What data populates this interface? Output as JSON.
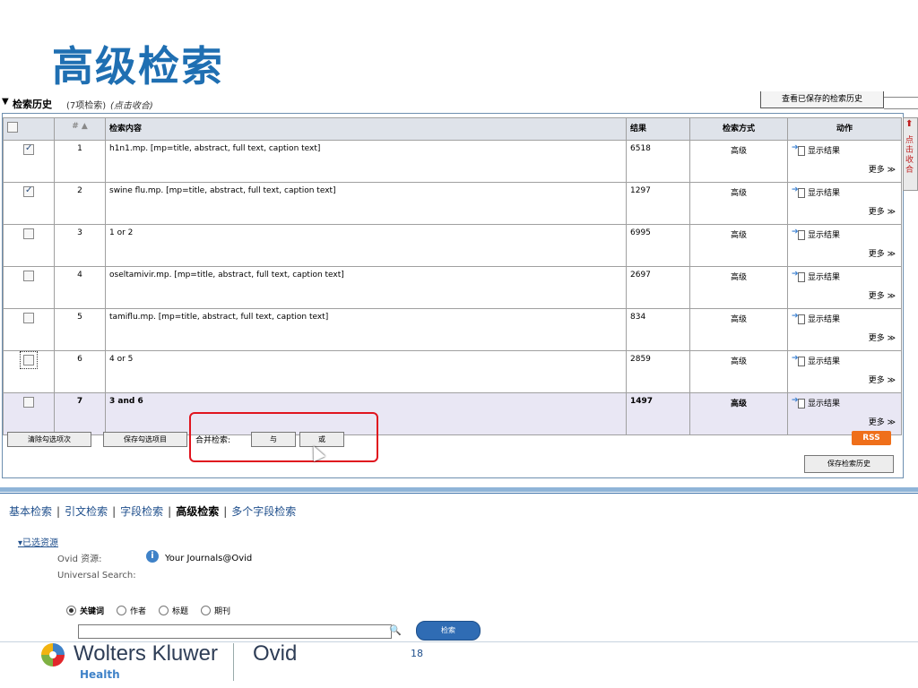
{
  "slide_title": "高级检索",
  "history": {
    "title": "检索历史",
    "count": "(7项检索)",
    "hint": "(点击收合)",
    "saved_button": "查看已保存的检索历史",
    "side_tab": "点击收合",
    "headers": {
      "num": "# ▲",
      "content": "检索内容",
      "results": "结果",
      "method": "检索方式",
      "action": "动作"
    },
    "show_label": "显示结果",
    "more_label": "更多 ≫",
    "rows": [
      {
        "checked": true,
        "num": "1",
        "content": "h1n1.mp. [mp=title, abstract, full text, caption text]",
        "results": "6518",
        "method": "高级"
      },
      {
        "checked": true,
        "num": "2",
        "content": "swine flu.mp. [mp=title, abstract, full text, caption text]",
        "results": "1297",
        "method": "高级"
      },
      {
        "checked": false,
        "num": "3",
        "content": "1 or 2",
        "results": "6995",
        "method": "高级"
      },
      {
        "checked": false,
        "num": "4",
        "content": "oseltamivir.mp. [mp=title, abstract, full text, caption text]",
        "results": "2697",
        "method": "高级"
      },
      {
        "checked": false,
        "num": "5",
        "content": "tamiflu.mp. [mp=title, abstract, full text, caption text]",
        "results": "834",
        "method": "高级"
      },
      {
        "checked": false,
        "num": "6",
        "content": "4 or 5",
        "results": "2859",
        "method": "高级"
      },
      {
        "checked": false,
        "num": "7",
        "content": "3 and 6",
        "results": "1497",
        "method": "高级"
      }
    ],
    "clear_button": "清除勾选项次",
    "save_selected_button": "保存勾选项目",
    "merge_label": "合并检索:",
    "and_button": "与",
    "or_button": "或",
    "rss": "RSS",
    "save_history_button": "保存检索历史"
  },
  "nav": {
    "items": [
      "基本检索",
      "引文检索",
      "字段检索",
      "高级检索",
      "多个字段检索"
    ],
    "current": "高级检索"
  },
  "resources": {
    "toggle": "▾已选资源",
    "ovid_label": "Ovid 资源:",
    "ovid_value": "Your Journals@Ovid",
    "universal_label": "Universal Search:"
  },
  "search": {
    "options": [
      "关键词",
      "作者",
      "标题",
      "期刊"
    ],
    "selected": "关键词",
    "button": "检索"
  },
  "footer": {
    "brand": "Wolters Kluwer",
    "sub": "Health",
    "product": "Ovid",
    "page": "18"
  },
  "colors": {
    "title": "#1f6fb2",
    "highlight": "#e0141e",
    "rss": "#ef6f1a"
  }
}
